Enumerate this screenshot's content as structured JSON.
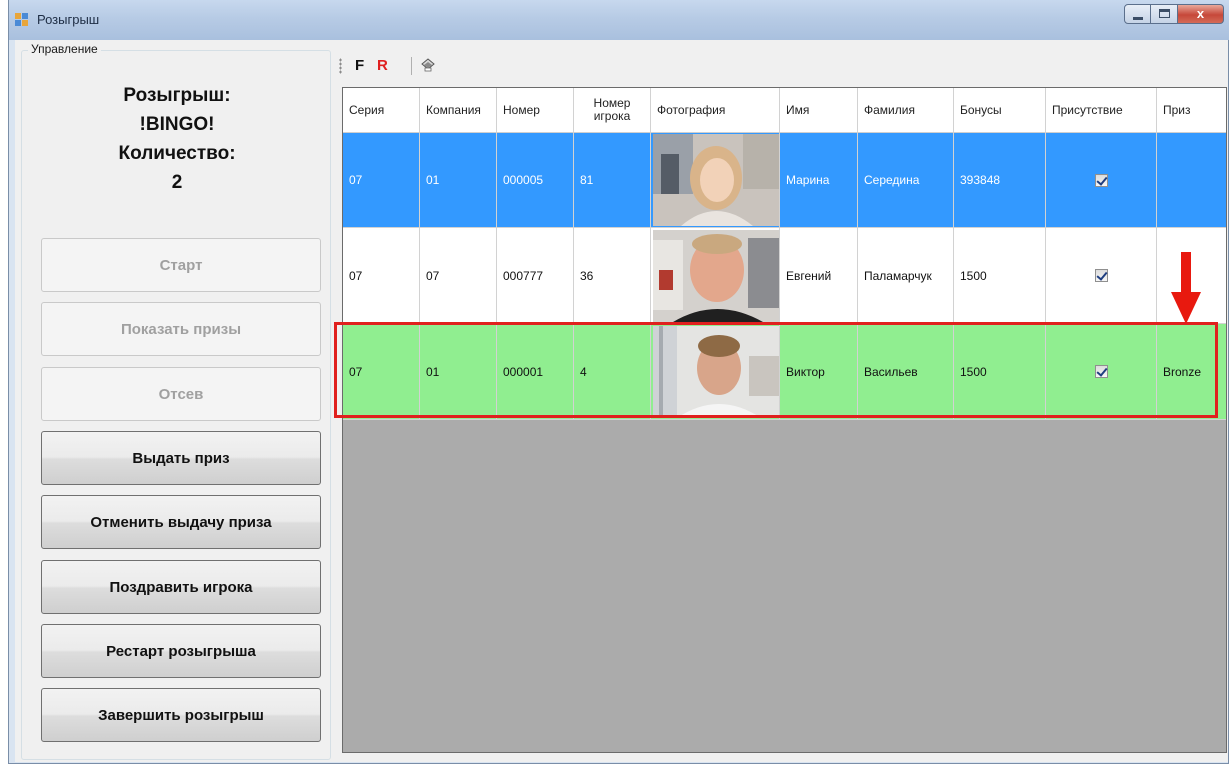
{
  "window": {
    "title": "Розыгрыш",
    "close_label": "x"
  },
  "control_panel": {
    "group_caption": "Управление",
    "draw_label": "Розыгрыш:",
    "draw_name": "!BINGO!",
    "count_label": "Количество:",
    "count_value": "2",
    "buttons": [
      {
        "label": "Старт",
        "enabled": false
      },
      {
        "label": "Показать призы",
        "enabled": false
      },
      {
        "label": "Отсев",
        "enabled": false
      },
      {
        "label": "Выдать приз",
        "enabled": true
      },
      {
        "label": "Отменить выдачу приза",
        "enabled": true
      },
      {
        "label": "Поздравить игрока",
        "enabled": true
      },
      {
        "label": "Рестарт розыгрыша",
        "enabled": true
      },
      {
        "label": "Завершить розыгрыш",
        "enabled": true
      }
    ]
  },
  "toolbar": {
    "f_label": "F",
    "r_label": "R",
    "print_icon": "printer-icon"
  },
  "grid": {
    "columns": [
      "Серия",
      "Компания",
      "Номер",
      "Номер игрока",
      "Фотография",
      "Имя",
      "Фамилия",
      "Бонусы",
      "Присутствие",
      "Приз"
    ],
    "rows": [
      {
        "series": "07",
        "company": "01",
        "number": "000005",
        "player_no": "81",
        "first_name": "Марина",
        "last_name": "Середина",
        "bonus": "393848",
        "present": true,
        "prize": "",
        "state": "selected"
      },
      {
        "series": "07",
        "company": "07",
        "number": "000777",
        "player_no": "36",
        "first_name": "Евгений",
        "last_name": "Паламарчук",
        "bonus": "1500",
        "present": true,
        "prize": "",
        "state": "normal"
      },
      {
        "series": "07",
        "company": "01",
        "number": "000001",
        "player_no": "4",
        "first_name": "Виктор",
        "last_name": "Васильев",
        "bonus": "1500",
        "present": true,
        "prize": "Bronze",
        "state": "winner"
      }
    ]
  },
  "colors": {
    "selected_row": "#3399ff",
    "winner_row": "#90ee90",
    "highlight": "#e0201e"
  }
}
